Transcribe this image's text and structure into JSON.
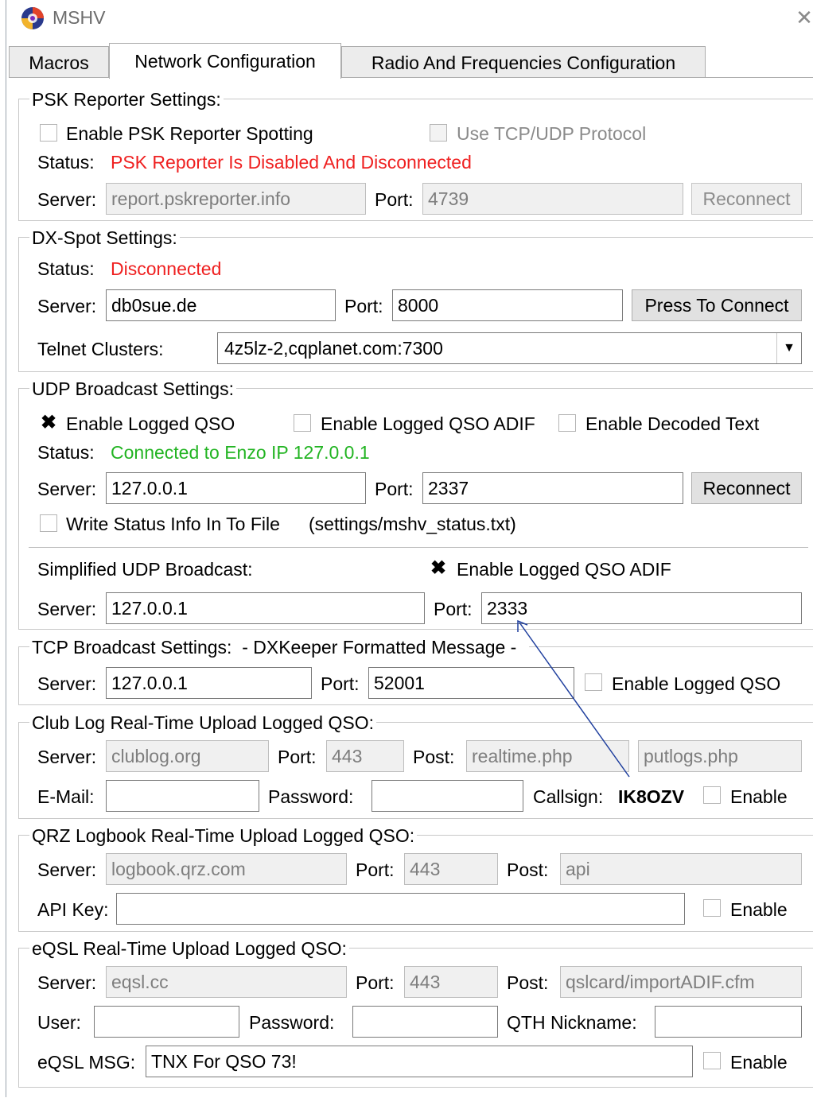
{
  "window": {
    "title": "MSHV"
  },
  "tabs": [
    {
      "label": "Macros"
    },
    {
      "label": "Network Configuration"
    },
    {
      "label": "Radio And Frequencies Configuration"
    }
  ],
  "psk": {
    "title": "PSK Reporter Settings:",
    "enable_label": "Enable PSK Reporter Spotting",
    "tcp_label": "Use TCP/UDP Protocol",
    "status_label": "Status:",
    "status_value": "PSK Reporter Is Disabled And Disconnected",
    "server_label": "Server:",
    "server_value": "report.pskreporter.info",
    "port_label": "Port:",
    "port_value": "4739",
    "reconnect_label": "Reconnect"
  },
  "dx": {
    "title": "DX-Spot Settings:",
    "status_label": "Status:",
    "status_value": "Disconnected",
    "server_label": "Server:",
    "server_value": "db0sue.de",
    "port_label": "Port:",
    "port_value": "8000",
    "connect_label": "Press To Connect",
    "clusters_label": "Telnet Clusters:",
    "clusters_value": "4z5lz-2,cqplanet.com:7300"
  },
  "udp": {
    "title": "UDP Broadcast Settings:",
    "logged_qso_label": "Enable Logged QSO",
    "logged_adif_label": "Enable Logged QSO ADIF",
    "decoded_label": "Enable Decoded Text",
    "status_label": "Status:",
    "status_value": "Connected to Enzo IP 127.0.0.1",
    "server_label": "Server:",
    "server_value": "127.0.0.1",
    "port_label": "Port:",
    "port_value": "2337",
    "reconnect_label": "Reconnect",
    "write_status_label": "Write Status Info In To File",
    "write_status_file": "(settings/mshv_status.txt)",
    "simplified_label": "Simplified UDP Broadcast:",
    "simplified_adif_label": "Enable Logged QSO ADIF",
    "s_server_label": "Server:",
    "s_server_value": "127.0.0.1",
    "s_port_label": "Port:",
    "s_port_value": "2333"
  },
  "tcp": {
    "title": "TCP Broadcast Settings:",
    "subtitle": "- DXKeeper Formatted Message -",
    "server_label": "Server:",
    "server_value": "127.0.0.1",
    "port_label": "Port:",
    "port_value": "52001",
    "enable_label": "Enable Logged QSO"
  },
  "clublog": {
    "title": "Club Log Real-Time Upload Logged QSO:",
    "server_label": "Server:",
    "server_value": "clublog.org",
    "port_label": "Port:",
    "port_value": "443",
    "post_label": "Post:",
    "post_value": "realtime.php",
    "post2_value": "putlogs.php",
    "email_label": "E-Mail:",
    "password_label": "Password:",
    "callsign_label": "Callsign:",
    "callsign_value": "IK8OZV",
    "enable_label": "Enable"
  },
  "qrz": {
    "title": "QRZ Logbook Real-Time Upload Logged QSO:",
    "server_label": "Server:",
    "server_value": "logbook.qrz.com",
    "port_label": "Port:",
    "port_value": "443",
    "post_label": "Post:",
    "post_value": "api",
    "apikey_label": "API Key:",
    "enable_label": "Enable"
  },
  "eqsl": {
    "title": "eQSL Real-Time Upload Logged QSO:",
    "server_label": "Server:",
    "server_value": "eqsl.cc",
    "port_label": "Port:",
    "port_value": "443",
    "post_label": "Post:",
    "post_value": "qslcard/importADIF.cfm",
    "user_label": "User:",
    "password_label": "Password:",
    "qth_label": "QTH Nickname:",
    "msg_label": "eQSL MSG:",
    "msg_value": "TNX For QSO 73!",
    "enable_label": "Enable"
  }
}
